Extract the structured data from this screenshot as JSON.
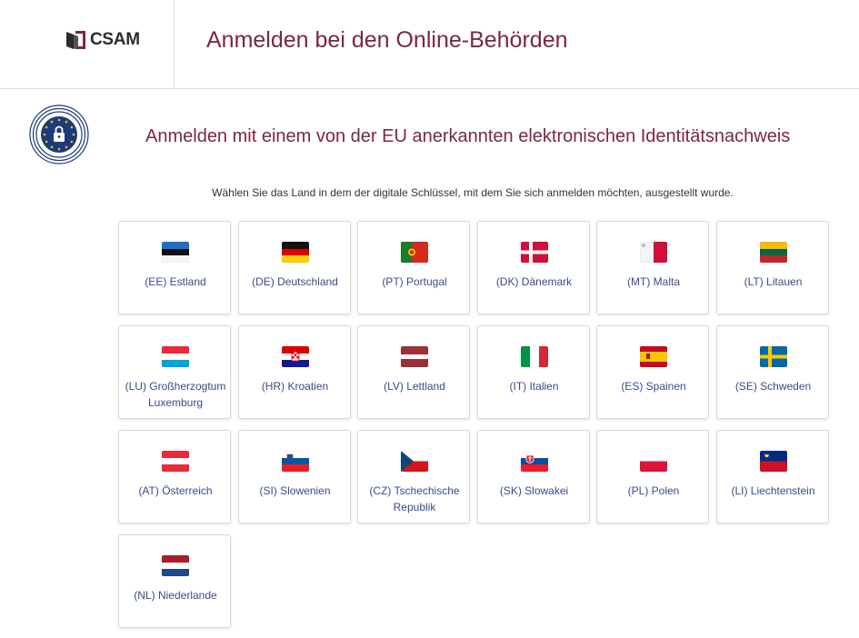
{
  "header": {
    "logo_text": "CSAM",
    "title": "Anmelden bei den Online-Behörden"
  },
  "panel": {
    "badge_icon": "eidas-lock-icon",
    "title": "Anmelden mit einem von der EU anerkannten elektronischen Identitätsnachweis",
    "instruction": "Wählen Sie das Land in dem der digitale Schlüssel, mit dem Sie sich anmelden möchten, ausgestellt wurde."
  },
  "colors": {
    "brand": "#7b2740",
    "link": "#3b4a8c"
  },
  "countries": [
    {
      "code": "EE",
      "label": "(EE) Estland",
      "flag": "ee"
    },
    {
      "code": "DE",
      "label": "(DE) Deutschland",
      "flag": "de"
    },
    {
      "code": "PT",
      "label": "(PT) Portugal",
      "flag": "pt"
    },
    {
      "code": "DK",
      "label": "(DK) Dänemark",
      "flag": "dk"
    },
    {
      "code": "MT",
      "label": "(MT) Malta",
      "flag": "mt"
    },
    {
      "code": "LT",
      "label": "(LT) Litauen",
      "flag": "lt"
    },
    {
      "code": "LU",
      "label": "(LU) Großherzogtum Luxemburg",
      "flag": "lu"
    },
    {
      "code": "HR",
      "label": "(HR) Kroatien",
      "flag": "hr"
    },
    {
      "code": "LV",
      "label": "(LV) Lettland",
      "flag": "lv"
    },
    {
      "code": "IT",
      "label": "(IT) Italien",
      "flag": "it"
    },
    {
      "code": "ES",
      "label": "(ES) Spainen",
      "flag": "es"
    },
    {
      "code": "SE",
      "label": "(SE) Schweden",
      "flag": "se"
    },
    {
      "code": "AT",
      "label": "(AT) Österreich",
      "flag": "at"
    },
    {
      "code": "SI",
      "label": "(SI) Slowenien",
      "flag": "si"
    },
    {
      "code": "CZ",
      "label": "(CZ) Tschechische Republik",
      "flag": "cz"
    },
    {
      "code": "SK",
      "label": "(SK) Slowakei",
      "flag": "sk"
    },
    {
      "code": "PL",
      "label": "(PL) Polen",
      "flag": "pl"
    },
    {
      "code": "LI",
      "label": "(LI) Liechtenstein",
      "flag": "li"
    },
    {
      "code": "NL",
      "label": "(NL) Niederlande",
      "flag": "nl"
    }
  ]
}
